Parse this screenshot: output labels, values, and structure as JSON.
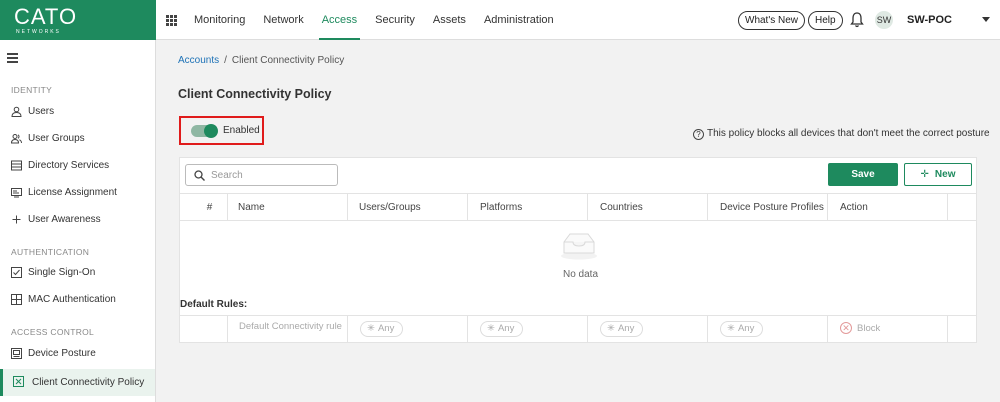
{
  "brand": {
    "name": "CATO",
    "tagline": "NETWORKS",
    "color": "#1e8a5e"
  },
  "topnav": {
    "apps_icon": "grid-icon",
    "items": [
      {
        "label": "Monitoring",
        "active": false
      },
      {
        "label": "Network",
        "active": false
      },
      {
        "label": "Access",
        "active": true
      },
      {
        "label": "Security",
        "active": false
      },
      {
        "label": "Assets",
        "active": false
      },
      {
        "label": "Administration",
        "active": false
      }
    ],
    "whats_new": "What's New",
    "help": "Help",
    "notifications_icon": "bell-icon",
    "avatar_initials": "SW",
    "account": "SW-POC"
  },
  "sidebar": {
    "menu_icon": "hamburger-icon",
    "sections": [
      {
        "title": "IDENTITY",
        "items": [
          {
            "label": "Users",
            "icon": "user-icon"
          },
          {
            "label": "User Groups",
            "icon": "users-icon"
          },
          {
            "label": "Directory Services",
            "icon": "list-icon"
          },
          {
            "label": "License Assignment",
            "icon": "license-icon"
          },
          {
            "label": "User Awareness",
            "icon": "plus-icon"
          }
        ]
      },
      {
        "title": "AUTHENTICATION",
        "items": [
          {
            "label": "Single Sign-On",
            "icon": "check-square-icon"
          },
          {
            "label": "MAC Authentication",
            "icon": "grid-square-icon"
          }
        ]
      },
      {
        "title": "ACCESS CONTROL",
        "items": [
          {
            "label": "Device Posture",
            "icon": "device-icon"
          },
          {
            "label": "Client Connectivity Policy",
            "icon": "policy-icon",
            "active": true
          }
        ]
      }
    ]
  },
  "breadcrumb": {
    "parent": "Accounts",
    "separator": "/",
    "current": "Client Connectivity Policy"
  },
  "page": {
    "title": "Client Connectivity Policy",
    "toggle": {
      "label": "Enabled",
      "on": true,
      "highlight_color": "#e01b1b"
    },
    "info_text": "This policy blocks all devices that don't meet the correct posture",
    "info_icon": "question-circle-icon"
  },
  "table": {
    "search_placeholder": "Search",
    "save_label": "Save",
    "new_label": "New",
    "columns": [
      "#",
      "Name",
      "Users/Groups",
      "Platforms",
      "Countries",
      "Device Posture Profiles",
      "Action"
    ],
    "empty_text": "No data",
    "default_rules_label": "Default Rules:",
    "default_rule": {
      "name": "Default Connectivity rule",
      "users": "Any",
      "platforms": "Any",
      "countries": "Any",
      "posture": "Any",
      "action": "Block"
    }
  }
}
